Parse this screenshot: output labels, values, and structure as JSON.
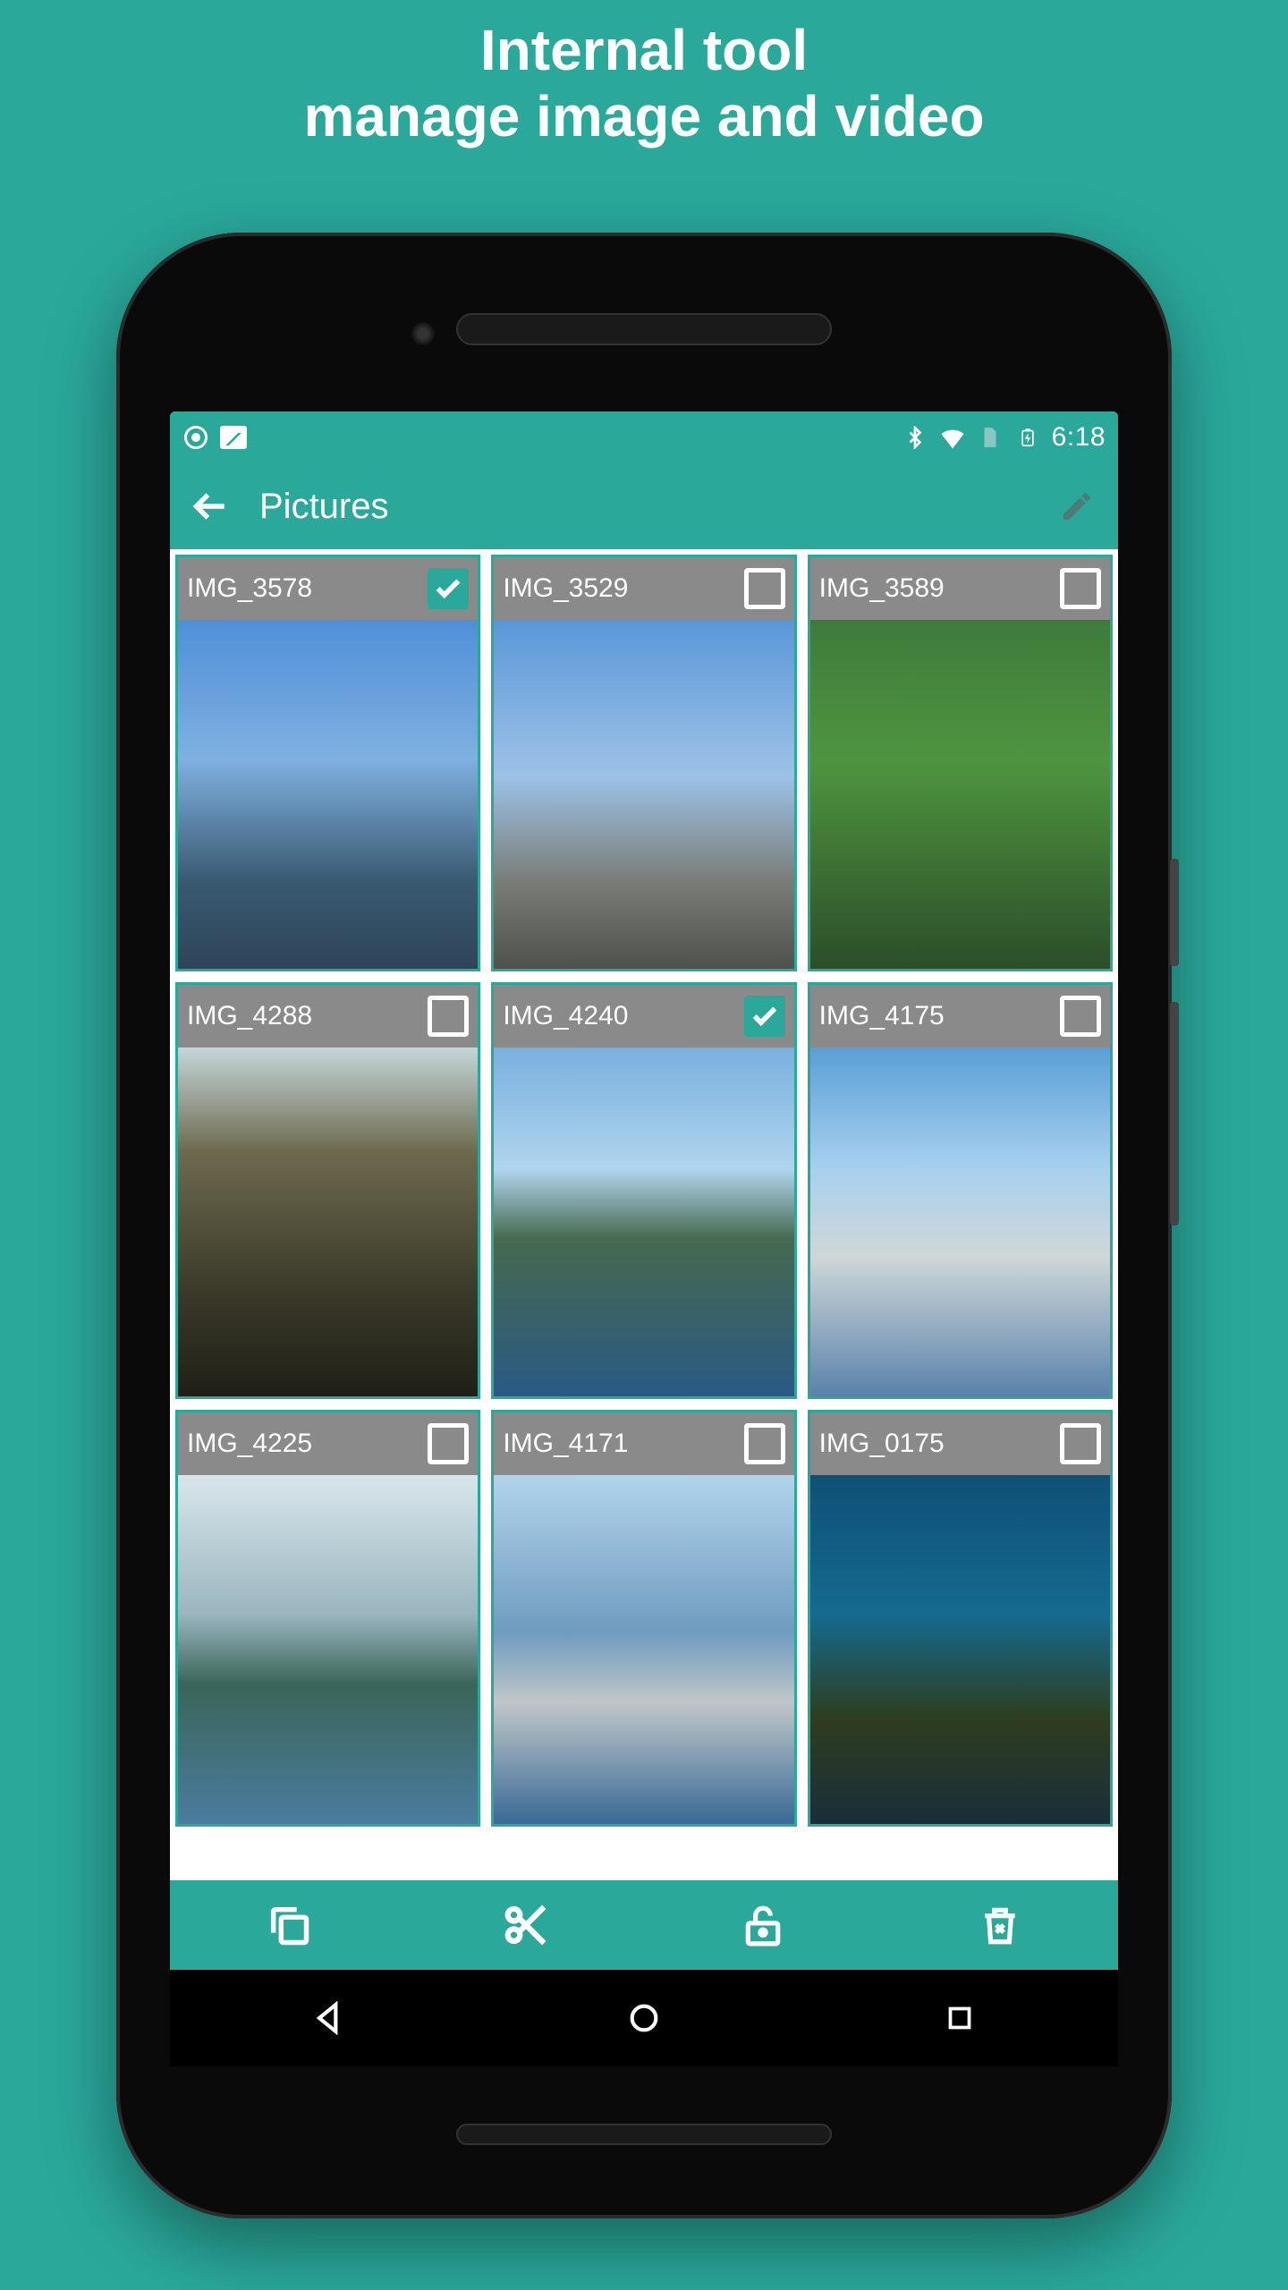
{
  "promo": {
    "line1": "Internal tool",
    "line2": "manage image and video"
  },
  "status_bar": {
    "time": "6:18"
  },
  "app_bar": {
    "title": "Pictures"
  },
  "gallery": {
    "items": [
      {
        "label": "IMG_3578",
        "checked": true
      },
      {
        "label": "IMG_3529",
        "checked": false
      },
      {
        "label": "IMG_3589",
        "checked": false
      },
      {
        "label": "IMG_4288",
        "checked": false
      },
      {
        "label": "IMG_4240",
        "checked": true
      },
      {
        "label": "IMG_4175",
        "checked": false
      },
      {
        "label": "IMG_4225",
        "checked": false
      },
      {
        "label": "IMG_4171",
        "checked": false
      },
      {
        "label": "IMG_0175",
        "checked": false
      }
    ]
  },
  "bottom_actions": {
    "copy": "copy",
    "cut": "cut",
    "lock": "lock",
    "delete": "delete"
  },
  "colors": {
    "accent": "#2aa99b",
    "thumb_header": "#8a8a8a"
  }
}
